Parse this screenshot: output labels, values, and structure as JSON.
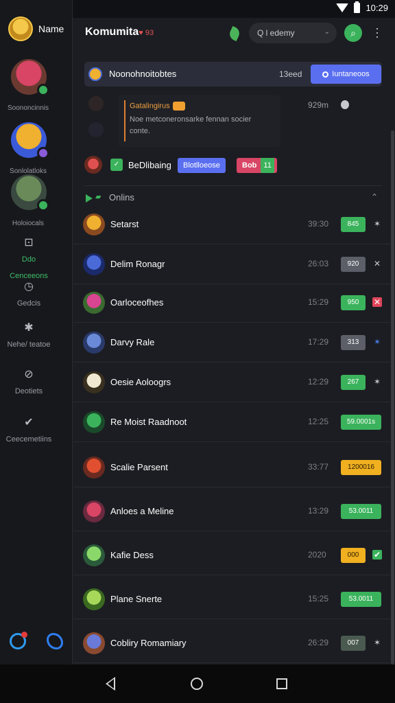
{
  "status": {
    "time": "10:29"
  },
  "sidebar": {
    "user_name": "Name",
    "avatars": [
      {
        "label": "Soononcinnis",
        "badge_color": "#3bb35c",
        "colors": [
          "#d84565",
          "#6a3a30"
        ]
      },
      {
        "label": "Sonlolatloks",
        "badge_color": "#8a5cd8",
        "colors": [
          "#f0b030",
          "#3a5ad8"
        ]
      },
      {
        "label": "Holoiocals",
        "badge_color": "#3bb35c",
        "colors": [
          "#6a8a5a",
          "#3a4a40"
        ]
      }
    ],
    "nav": [
      {
        "icon": "gamepad-icon",
        "glyph": "⊡",
        "label": "Ddo",
        "sublabel": "Cenceeons",
        "active": true
      },
      {
        "icon": "clock-icon",
        "glyph": "◷",
        "label": "Gedcis",
        "active": false
      },
      {
        "icon": "gear-icon",
        "glyph": "✱",
        "label": "Nehe/ teatoe",
        "active": false
      },
      {
        "icon": "compass-icon",
        "glyph": "⊘",
        "label": "Deotiets",
        "active": false
      },
      {
        "icon": "check-circle-icon",
        "glyph": "✔",
        "label": "Ceecemetiins",
        "active": false
      }
    ]
  },
  "header": {
    "title": "Komumita",
    "title_suffix": "♥ 93",
    "search_placeholder": "Q  l edemy",
    "search_chevron": "⌄",
    "search_go": "⌕"
  },
  "notification": {
    "text": "Noonohnoitobtes",
    "count": "13eed",
    "button": "Iuntaneoos"
  },
  "message": {
    "title": "Gatalingirus",
    "body": "Noe metconeronsarke fennan socier conte.",
    "time": "929m"
  },
  "pinned": {
    "title": "BeDlibaing",
    "tag_a": "Blotlloeose",
    "tag_b": "Bob",
    "tag_b_count": "11"
  },
  "section": {
    "title": "Onlins",
    "flag": "▰"
  },
  "members": [
    {
      "name": "Setarst",
      "time": "39:30",
      "badge": "845",
      "style": "green",
      "action": "✶",
      "action_style": "plain",
      "colors": [
        "#f0b030",
        "#8a4a20"
      ]
    },
    {
      "name": "Delim Ronagr",
      "time": "26:03",
      "badge": "920",
      "style": "gray",
      "action": "✕",
      "action_style": "plain",
      "colors": [
        "#4a6ad8",
        "#1a2a6a"
      ]
    },
    {
      "name": "Oarloceofhes",
      "time": "15:29",
      "badge": "950",
      "style": "green",
      "action": "✕",
      "action_style": "red",
      "colors": [
        "#d84590",
        "#3a6a30"
      ]
    },
    {
      "name": "Darvy Rale",
      "time": "17:29",
      "badge": "313",
      "style": "gray",
      "action": "✶",
      "action_style": "blue",
      "colors": [
        "#6a8ad8",
        "#2a3a6a"
      ]
    },
    {
      "name": "Oesie Aoloogrs",
      "time": "12:29",
      "badge": "267",
      "style": "green",
      "action": "✶",
      "action_style": "plain",
      "colors": [
        "#f0e8d0",
        "#3a3020"
      ]
    },
    {
      "name": "Re Moist Raadnoot",
      "time": "12:25",
      "badge": "59.0001s",
      "style": "green",
      "action": "",
      "action_style": "plain",
      "colors": [
        "#3bb35c",
        "#1a4a2a"
      ]
    },
    {
      "name": "Scalie Parsent",
      "time": "33:77",
      "badge": "1200016",
      "style": "amber",
      "action": "",
      "action_style": "plain",
      "colors": [
        "#e05030",
        "#6a2a20"
      ]
    },
    {
      "name": "Anloes a Meline",
      "time": "13:29",
      "badge": "53.0011",
      "style": "green",
      "action": "",
      "action_style": "plain",
      "colors": [
        "#d84565",
        "#6a2a40"
      ]
    },
    {
      "name": "Kafie Dess",
      "time": "2020",
      "badge": "000",
      "style": "amber",
      "action": "✔",
      "action_style": "green",
      "colors": [
        "#8ad86a",
        "#2a5a3a"
      ]
    },
    {
      "name": "Plane Snerte",
      "time": "15:25",
      "badge": "53.0011",
      "style": "green",
      "action": "",
      "action_style": "plain",
      "colors": [
        "#a8d85a",
        "#3a6a20"
      ]
    },
    {
      "name": "Cobliry Romamiary",
      "time": "26:29",
      "badge": "007",
      "style": "dark",
      "action": "✶",
      "action_style": "plain",
      "colors": [
        "#6a7ad8",
        "#8a4a30"
      ]
    }
  ]
}
